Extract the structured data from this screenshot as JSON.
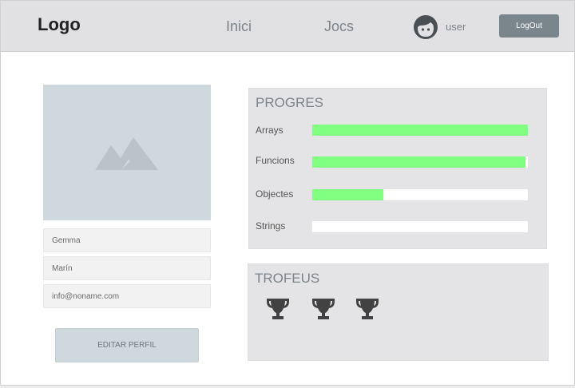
{
  "header": {
    "logo": "Logo",
    "nav": [
      {
        "label": "Inici"
      },
      {
        "label": "Jocs"
      }
    ],
    "user": "user",
    "logout_label": "LogOut"
  },
  "profile": {
    "first_name": "Gemma",
    "last_name": "Marín",
    "email": "info@noname.com",
    "edit_label": "EDITAR PERFIL"
  },
  "progress": {
    "title": "PROGRES",
    "items": [
      {
        "label": "Arrays",
        "value": 1.0
      },
      {
        "label": "Funcions",
        "value": 0.99
      },
      {
        "label": "Objectes",
        "value": 0.33
      },
      {
        "label": "Strings",
        "value": 0.0
      }
    ]
  },
  "trophies": {
    "title": "TROFEUS",
    "count": 3
  },
  "colors": {
    "progress_fill": "#80ff80",
    "logout_bg": "#7b868c"
  }
}
